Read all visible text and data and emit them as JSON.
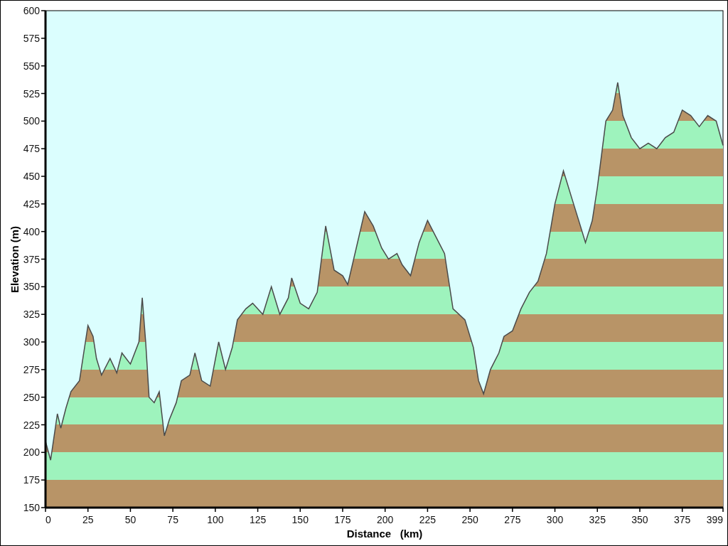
{
  "chart_data": {
    "type": "area",
    "xlabel": "Distance   (km)",
    "ylabel": "Elevation (m)",
    "x": [
      0,
      3,
      7,
      9,
      12,
      15,
      20,
      25,
      28,
      30,
      33,
      38,
      42,
      45,
      50,
      55,
      57,
      59,
      61,
      64,
      67,
      70,
      73,
      77,
      80,
      85,
      88,
      92,
      97,
      102,
      106,
      110,
      113,
      118,
      122,
      128,
      133,
      138,
      143,
      145,
      150,
      155,
      160,
      165,
      170,
      175,
      178,
      183,
      188,
      193,
      198,
      202,
      207,
      210,
      215,
      220,
      225,
      230,
      235,
      240,
      247,
      252,
      255,
      258,
      262,
      267,
      270,
      275,
      280,
      285,
      290,
      295,
      300,
      305,
      310,
      315,
      318,
      322,
      325,
      330,
      334,
      337,
      340,
      345,
      350,
      355,
      360,
      365,
      370,
      375,
      380,
      385,
      390,
      395,
      399
    ],
    "values": [
      210,
      193,
      235,
      222,
      240,
      255,
      265,
      315,
      305,
      285,
      270,
      285,
      272,
      290,
      280,
      300,
      340,
      300,
      250,
      245,
      255,
      215,
      230,
      245,
      265,
      270,
      290,
      265,
      260,
      300,
      275,
      295,
      320,
      330,
      335,
      325,
      350,
      325,
      340,
      358,
      335,
      330,
      345,
      405,
      365,
      360,
      352,
      385,
      418,
      405,
      385,
      375,
      380,
      370,
      360,
      390,
      410,
      395,
      380,
      330,
      320,
      295,
      265,
      253,
      275,
      290,
      305,
      310,
      330,
      345,
      355,
      380,
      425,
      455,
      430,
      405,
      390,
      410,
      440,
      500,
      510,
      535,
      505,
      485,
      475,
      480,
      475,
      485,
      490,
      510,
      505,
      495,
      505,
      500,
      478
    ],
    "xlim": [
      0,
      399
    ],
    "ylim": [
      150,
      600
    ],
    "xticks": [
      0,
      25,
      50,
      75,
      100,
      125,
      150,
      175,
      200,
      225,
      250,
      275,
      300,
      325,
      350,
      375,
      399
    ],
    "yticks": [
      150,
      175,
      200,
      225,
      250,
      275,
      300,
      325,
      350,
      375,
      400,
      425,
      450,
      475,
      500,
      525,
      550,
      575,
      600
    ]
  }
}
